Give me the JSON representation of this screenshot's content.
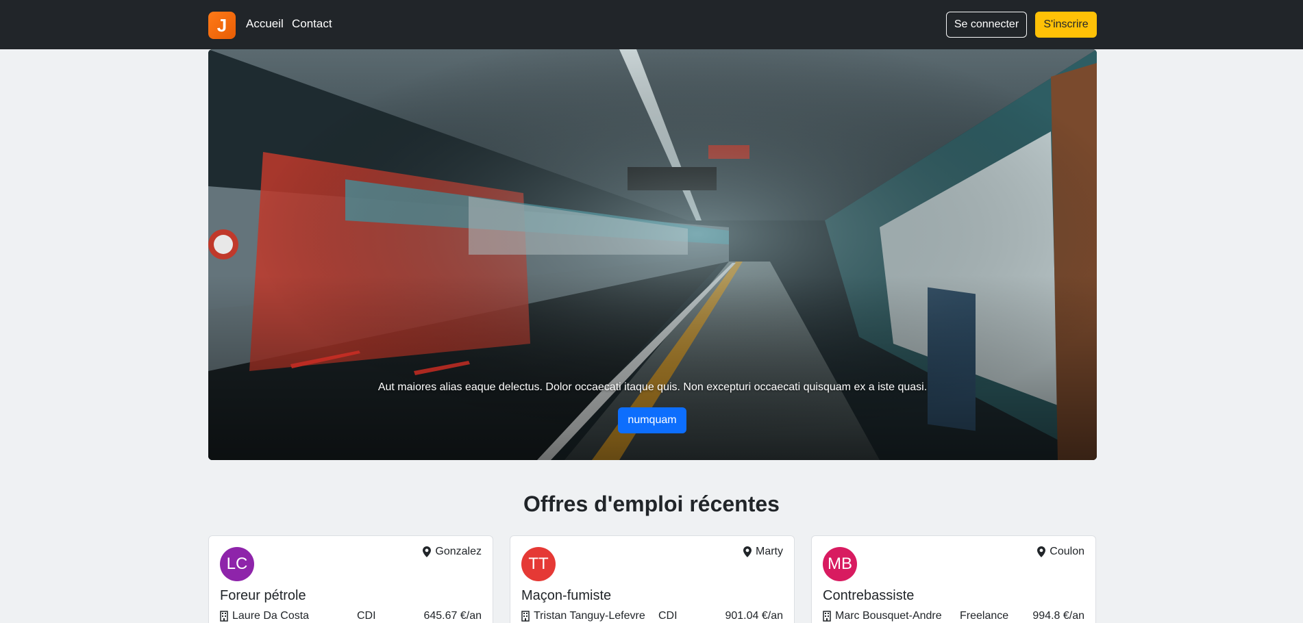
{
  "navbar": {
    "logo_letter": "J",
    "links": [
      {
        "label": "Accueil"
      },
      {
        "label": "Contact"
      }
    ],
    "login_label": "Se connecter",
    "signup_label": "S'inscrire"
  },
  "hero": {
    "text": "Aut maiores alias eaque delectus. Dolor occaecati itaque quis. Non excepturi occaecati quisquam ex a iste quasi.",
    "button_label": "numquam"
  },
  "section": {
    "title": "Offres d'emploi récentes"
  },
  "jobs": [
    {
      "initials": "LC",
      "avatar_color": "#8e24aa",
      "location": "Gonzalez",
      "title": "Foreur pétrole",
      "company": "Laure Da Costa",
      "contract": "CDI",
      "salary": "645.67 €/an"
    },
    {
      "initials": "TT",
      "avatar_color": "#e53935",
      "location": "Marty",
      "title": "Maçon-fumiste",
      "company": "Tristan Tanguy-Lefevre",
      "contract": "CDI",
      "salary": "901.04 €/an"
    },
    {
      "initials": "MB",
      "avatar_color": "#d81b60",
      "location": "Coulon",
      "title": "Contrebassiste",
      "company": "Marc Bousquet-Andre",
      "contract": "Freelance",
      "salary": "994.8 €/an"
    }
  ],
  "icons": {
    "location": "map-pin-icon",
    "company": "building-icon"
  },
  "colors": {
    "navbar_bg": "#212529",
    "signup_button": "#ffc107",
    "hero_button": "#0d6efd",
    "page_bg": "#eff1f3"
  }
}
